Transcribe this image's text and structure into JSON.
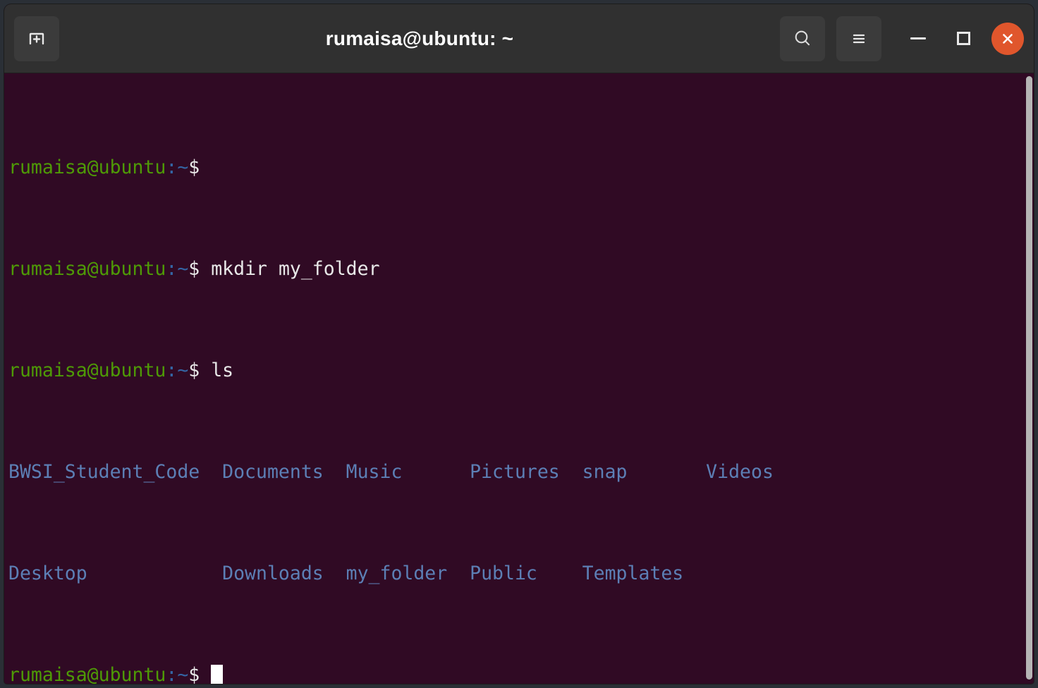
{
  "window": {
    "title": "rumaisa@ubuntu: ~",
    "colors": {
      "titlebar_bg": "#303030",
      "terminal_bg": "#300a24",
      "close_button": "#e0562c",
      "prompt_user_host": "#4e9a06",
      "prompt_path": "#3465a4",
      "directory_listing": "#5c7fb5",
      "foreground": "#d3d7cf",
      "scrollbar": "#b5b5b5"
    }
  },
  "titlebar": {
    "new_tab_icon": "new-tab-icon",
    "search_icon": "search-icon",
    "menu_icon": "hamburger-menu-icon",
    "minimize_icon": "minimize-icon",
    "maximize_icon": "maximize-icon",
    "close_icon": "close-icon"
  },
  "terminal": {
    "prompt": {
      "user_host": "rumaisa@ubuntu",
      "path": ":~",
      "symbol": "$"
    },
    "lines": [
      {
        "type": "prompt",
        "command": ""
      },
      {
        "type": "prompt",
        "command": " mkdir my_folder"
      },
      {
        "type": "prompt",
        "command": " ls"
      }
    ],
    "ls_output": {
      "row1": [
        "BWSI_Student_Code",
        "Documents",
        "Music",
        "Pictures",
        "snap",
        "Videos"
      ],
      "row2": [
        "Desktop",
        "Downloads",
        "my_folder",
        "Public",
        "Templates"
      ],
      "row1_text": "BWSI_Student_Code  Documents  Music      Pictures  snap       Videos",
      "row2_text": "Desktop            Downloads  my_folder  Public    Templates"
    },
    "cursor": "block-cursor",
    "scrollbar": "vertical-scrollbar"
  }
}
